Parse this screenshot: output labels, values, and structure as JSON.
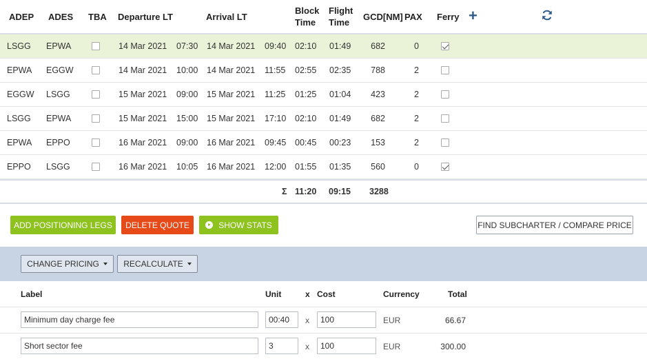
{
  "legs_header": {
    "adep": "ADEP",
    "ades": "ADES",
    "tba": "TBA",
    "departure": "Departure LT",
    "arrival": "Arrival LT",
    "block_1": "Block",
    "block_2": "Time",
    "flight_1": "Flight",
    "flight_2": "Time",
    "gcd": "GCD[NM]",
    "pax": "PAX",
    "ferry": "Ferry",
    "add_icon": "plus-icon",
    "refresh_icon": "refresh-icon"
  },
  "legs": [
    {
      "adep": "LSGG",
      "ades": "EPWA",
      "tba": false,
      "dep_date": "14 Mar 2021",
      "dep_time": "07:30",
      "arr_date": "14 Mar 2021",
      "arr_time": "09:40",
      "block": "02:10",
      "flight": "01:49",
      "gcd": "682",
      "pax": "0",
      "ferry": true,
      "selected": true
    },
    {
      "adep": "EPWA",
      "ades": "EGGW",
      "tba": false,
      "dep_date": "14 Mar 2021",
      "dep_time": "10:00",
      "arr_date": "14 Mar 2021",
      "arr_time": "11:55",
      "block": "02:55",
      "flight": "02:35",
      "gcd": "788",
      "pax": "2",
      "ferry": false,
      "selected": false
    },
    {
      "adep": "EGGW",
      "ades": "LSGG",
      "tba": false,
      "dep_date": "15 Mar 2021",
      "dep_time": "09:00",
      "arr_date": "15 Mar 2021",
      "arr_time": "11:25",
      "block": "01:25",
      "flight": "01:04",
      "gcd": "423",
      "pax": "2",
      "ferry": false,
      "selected": false
    },
    {
      "adep": "LSGG",
      "ades": "EPWA",
      "tba": false,
      "dep_date": "15 Mar 2021",
      "dep_time": "15:00",
      "arr_date": "15 Mar 2021",
      "arr_time": "17:10",
      "block": "02:10",
      "flight": "01:49",
      "gcd": "682",
      "pax": "2",
      "ferry": false,
      "selected": false
    },
    {
      "adep": "EPWA",
      "ades": "EPPO",
      "tba": false,
      "dep_date": "16 Mar 2021",
      "dep_time": "09:00",
      "arr_date": "16 Mar 2021",
      "arr_time": "09:45",
      "block": "00:45",
      "flight": "00:23",
      "gcd": "153",
      "pax": "2",
      "ferry": false,
      "selected": false
    },
    {
      "adep": "EPPO",
      "ades": "LSGG",
      "tba": false,
      "dep_date": "16 Mar 2021",
      "dep_time": "10:05",
      "arr_date": "16 Mar 2021",
      "arr_time": "12:00",
      "block": "01:55",
      "flight": "01:35",
      "gcd": "560",
      "pax": "0",
      "ferry": true,
      "selected": false
    }
  ],
  "totals": {
    "sigma": "Σ",
    "block": "11:20",
    "flight": "09:15",
    "gcd": "3288"
  },
  "actions": {
    "add_positioning": "ADD POSITIONING LEGS",
    "delete_quote": "DELETE QUOTE",
    "show_stats": "SHOW STATS",
    "find_subcharter": "FIND SUBCHARTER / COMPARE PRICE"
  },
  "pricing_bar": {
    "change_pricing": "CHANGE PRICING",
    "recalculate": "RECALCULATE"
  },
  "pricing_header": {
    "label": "Label",
    "unit": "Unit",
    "x": "x",
    "cost": "Cost",
    "currency": "Currency",
    "total": "Total"
  },
  "pricing_rows": [
    {
      "label": "Minimum day charge fee",
      "unit": "00:40",
      "x": "x",
      "cost": "100",
      "currency": "EUR",
      "total": "66.67"
    },
    {
      "label": "Short sector fee",
      "unit": "3",
      "x": "x",
      "cost": "100",
      "currency": "EUR",
      "total": "300.00"
    }
  ],
  "colors": {
    "green": "#8dc21f",
    "red": "#e64a19",
    "selected_row": "#eaf3d8",
    "pricing_bar": "#c8d4e4",
    "icon_blue": "#2e5a8c"
  }
}
